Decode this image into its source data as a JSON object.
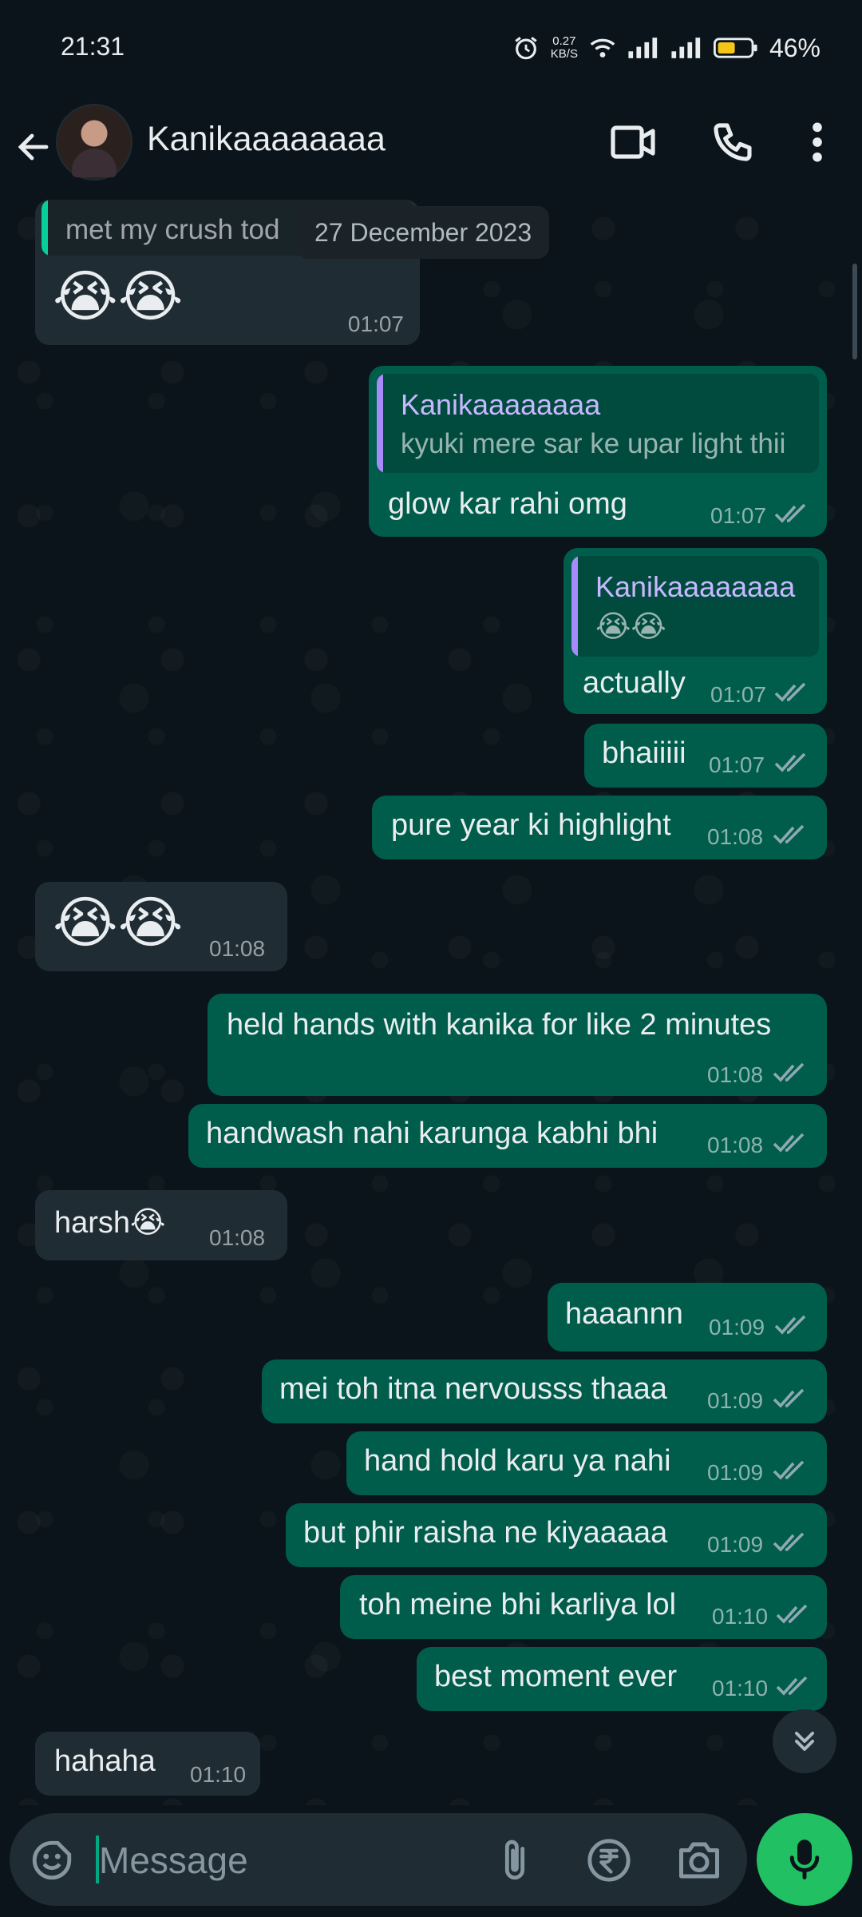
{
  "status_bar": {
    "time": "21:31",
    "speed": "0.27",
    "speed_unit": "KB/S",
    "battery": "46%"
  },
  "header": {
    "contact_name": "Kanikaaaaaaaa"
  },
  "chat": {
    "date_chip": "27 December 2023",
    "messages": [
      {
        "dir": "in",
        "quote_text": "met my crush tod",
        "text": "😭😭",
        "time": "01:07"
      },
      {
        "dir": "out",
        "quote_author": "Kanikaaaaaaaa",
        "quote_text": "kyuki mere sar ke upar light thii",
        "text": "glow kar rahi omg",
        "time": "01:07"
      },
      {
        "dir": "out",
        "quote_author": "Kanikaaaaaaaa",
        "quote_text": "😭😭",
        "text": "actually",
        "time": "01:07"
      },
      {
        "dir": "out",
        "text": "bhaiiiii",
        "time": "01:07"
      },
      {
        "dir": "out",
        "text": "pure year ki highlight",
        "time": "01:08"
      },
      {
        "dir": "in",
        "text": "😭😭",
        "time": "01:08"
      },
      {
        "dir": "out",
        "text": "held hands with kanika for like 2 minutes",
        "time": "01:08"
      },
      {
        "dir": "out",
        "text": "handwash nahi karunga kabhi bhi",
        "time": "01:08"
      },
      {
        "dir": "in",
        "text": "harsh😭",
        "time": "01:08"
      },
      {
        "dir": "out",
        "text": "haaannn",
        "time": "01:09"
      },
      {
        "dir": "out",
        "text": "mei toh itna nervousss thaaa",
        "time": "01:09"
      },
      {
        "dir": "out",
        "text": "hand hold karu ya nahi",
        "time": "01:09"
      },
      {
        "dir": "out",
        "text": "but phir raisha ne kiyaaaaa",
        "time": "01:09"
      },
      {
        "dir": "out",
        "text": "toh meine bhi karliya lol",
        "time": "01:10"
      },
      {
        "dir": "out",
        "text": "best moment ever",
        "time": "01:10"
      },
      {
        "dir": "in",
        "text": "hahaha",
        "time": "01:10"
      }
    ]
  },
  "input": {
    "placeholder": "Message"
  },
  "colors": {
    "accent": "#00a884",
    "outgoing": "#005c4b",
    "incoming": "#1f2c33",
    "ticks": "#8fa9b3",
    "mic": "#21c063"
  },
  "icons": [
    "alarm-icon",
    "wifi-icon",
    "signal-icon",
    "battery-icon",
    "back-arrow-icon",
    "video-call-icon",
    "phone-icon",
    "more-vert-icon",
    "double-tick-icon",
    "chevron-double-down-icon",
    "sticker-icon",
    "attach-icon",
    "rupee-icon",
    "camera-icon",
    "mic-icon"
  ]
}
